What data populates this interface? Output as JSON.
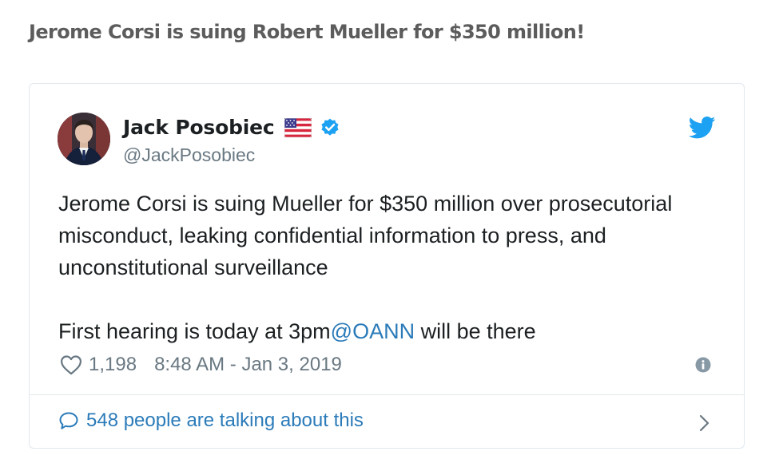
{
  "headline": "Jerome Corsi is suing Robert Mueller for $350 million!",
  "tweet": {
    "author": {
      "name": "Jack Posobiec",
      "handle": "@JackPosobiec",
      "flag_icon": "us-flag-icon",
      "verified_icon": "verified-badge-icon"
    },
    "brand_icon": "twitter-bird-icon",
    "body_paragraph_1": "Jerome Corsi is suing Mueller for $350 million over prosecutorial misconduct, leaking confidential information to press, and unconstitutional surveillance",
    "body_paragraph_2_prefix": "First hearing is today at 3pm",
    "mention": "@OANN",
    "body_paragraph_2_suffix": " will be there",
    "likes": "1,198",
    "timestamp": "8:48 AM - Jan 3, 2019",
    "footer_text": "548 people are talking about this"
  },
  "colors": {
    "link": "#2b7bb9",
    "text": "#1c2022",
    "muted": "#697882",
    "border": "#e1e8ed",
    "twitter_blue": "#1da1f2"
  }
}
